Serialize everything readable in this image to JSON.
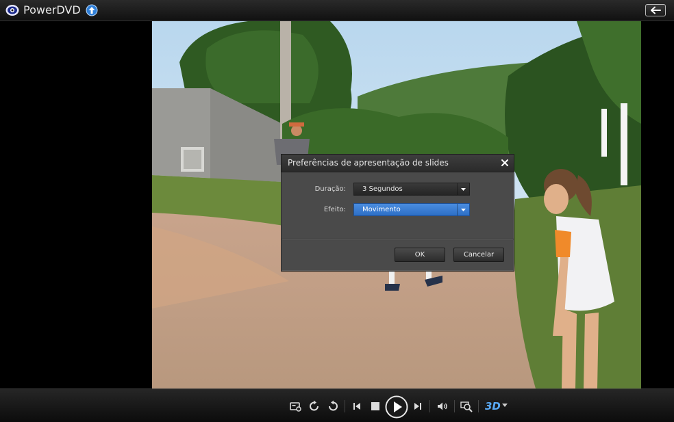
{
  "app": {
    "title": "PowerDVD"
  },
  "dialog": {
    "title": "Preferências de apresentação de slides",
    "duration_label": "Duração:",
    "duration_value": "3 Segundos",
    "effect_label": "Efeito:",
    "effect_value": "Movimento",
    "ok_label": "OK",
    "cancel_label": "Cancelar"
  },
  "controls": {
    "mode_3d_label": "3D",
    "icons": [
      "slideshow-settings-icon",
      "rotate-left-icon",
      "rotate-right-icon",
      "previous-icon",
      "stop-icon",
      "play-icon",
      "next-icon",
      "volume-icon",
      "zoom-icon",
      "3d-icon"
    ]
  },
  "colors": {
    "selected_blue": "#3a7bd5",
    "dialog_bg": "#4a4a4a"
  }
}
